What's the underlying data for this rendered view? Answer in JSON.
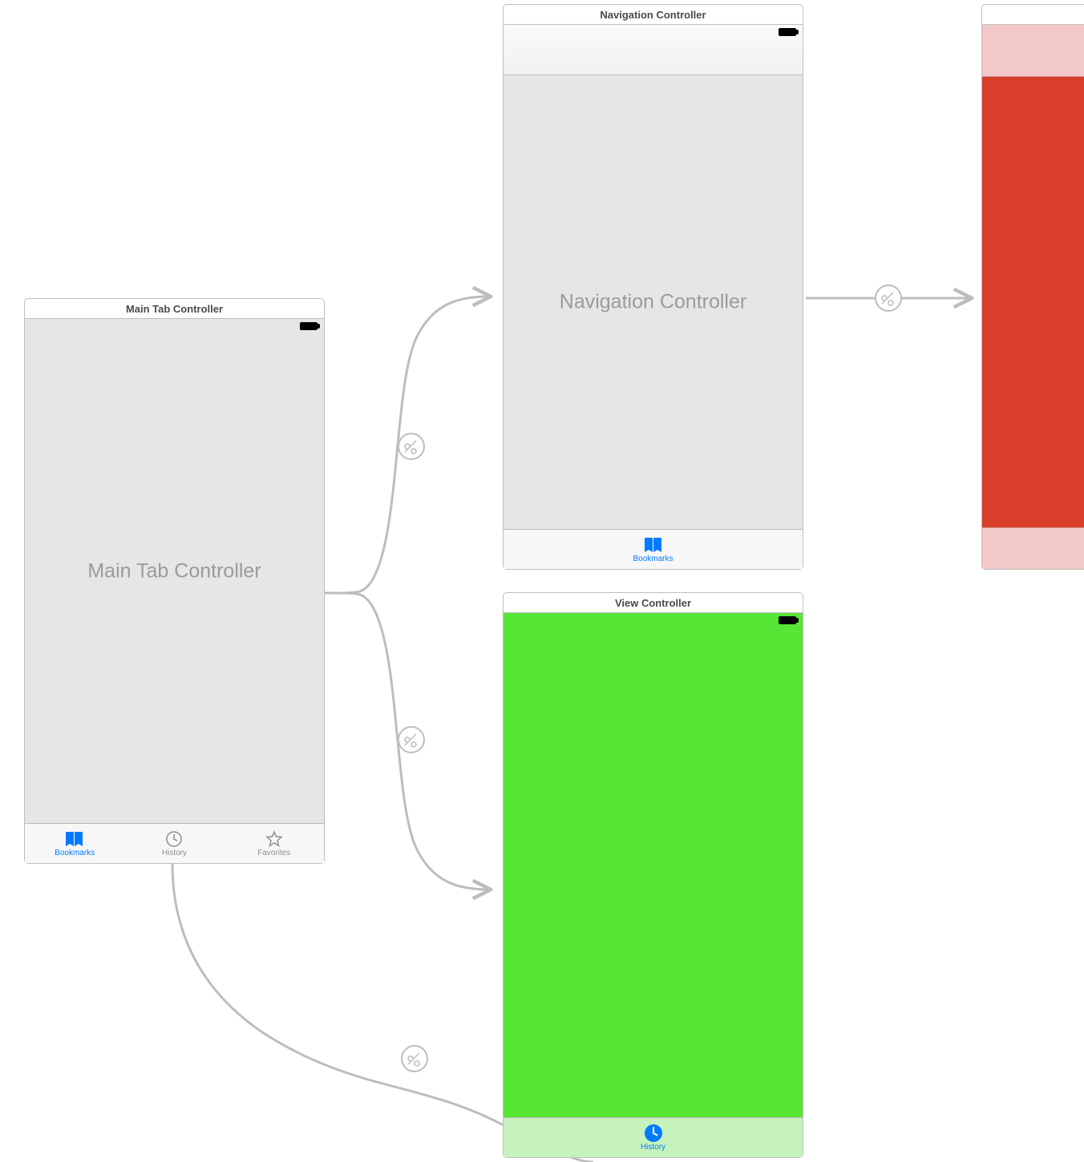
{
  "scenes": {
    "main_tab": {
      "title": "Main Tab Controller",
      "center_label": "Main Tab Controller",
      "tabs": [
        {
          "label": "Bookmarks",
          "icon": "bookmarks-icon",
          "active": true
        },
        {
          "label": "History",
          "icon": "history-icon",
          "active": false
        },
        {
          "label": "Favorites",
          "icon": "favorites-icon",
          "active": false
        }
      ]
    },
    "nav_controller": {
      "title": "Navigation Controller",
      "center_label": "Navigation Controller",
      "tab": {
        "label": "Bookmarks",
        "icon": "bookmarks-icon",
        "active": true
      }
    },
    "view_controller_green": {
      "title": "View Controller",
      "body_color": "#58E636",
      "tabbar_bg": "#C6F3BD",
      "tab": {
        "label": "History",
        "icon": "history-icon",
        "active": true
      }
    },
    "red_scene": {
      "top_color": "#F2C8C8",
      "body_color": "#D93E2B",
      "bottom_color": "#F2C8C8"
    }
  }
}
